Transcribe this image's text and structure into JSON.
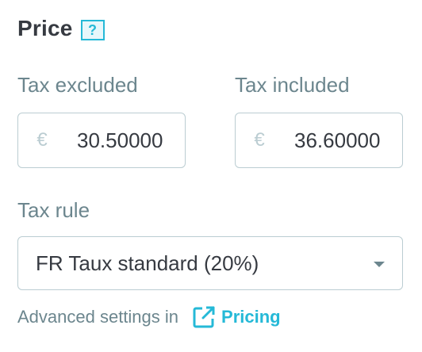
{
  "section": {
    "title": "Price",
    "help_icon_glyph": "?",
    "help_icon_name": "help-icon"
  },
  "fields": {
    "tax_excluded": {
      "label": "Tax excluded",
      "currency_symbol": "€",
      "value": "30.50000"
    },
    "tax_included": {
      "label": "Tax included",
      "currency_symbol": "€",
      "value": "36.60000"
    }
  },
  "tax_rule": {
    "label": "Tax rule",
    "selected": "FR Taux standard (20%)"
  },
  "advanced": {
    "text": "Advanced settings in",
    "link_label": "Pricing",
    "link_icon": "external-link-icon"
  },
  "colors": {
    "accent": "#25b9d7",
    "text_dark": "#363a41",
    "text_muted": "#6c868e",
    "border": "#bbcdd2"
  }
}
